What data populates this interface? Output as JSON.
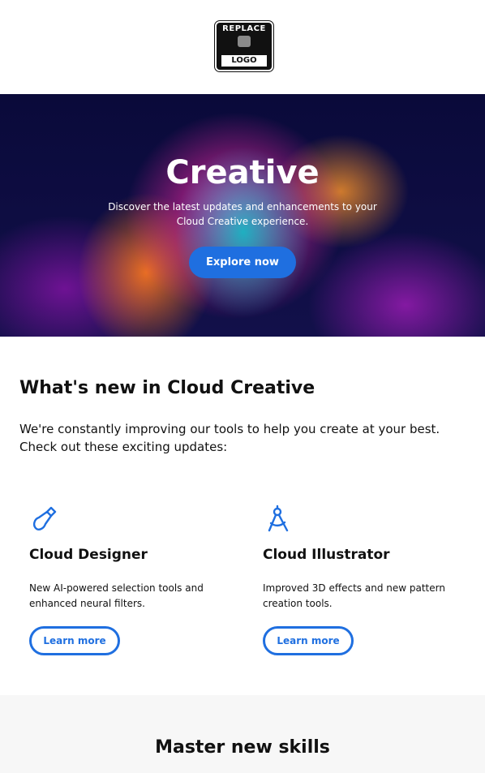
{
  "logo": {
    "line1": "REPLACE",
    "line2": "LOGO"
  },
  "hero": {
    "title": "Creative",
    "subtitle": "Discover the latest updates and enhancements to your Cloud Creative experience.",
    "cta_label": "Explore now"
  },
  "whats_new": {
    "heading": "What's new in Cloud Creative",
    "intro": "We're constantly improving our tools to help you create at your best. Check out these exciting updates:"
  },
  "cards": [
    {
      "title": "Cloud Designer",
      "description": "New AI-powered selection tools and enhanced neural filters.",
      "button": "Learn more",
      "icon": "brush-icon"
    },
    {
      "title": "Cloud Illustrator",
      "description": "Improved 3D effects and new pattern creation tools.",
      "button": "Learn more",
      "icon": "compass-icon"
    }
  ],
  "skills": {
    "heading": "Master new skills"
  },
  "colors": {
    "accent": "#1f6fe0",
    "panel": "#f7f7f7"
  }
}
